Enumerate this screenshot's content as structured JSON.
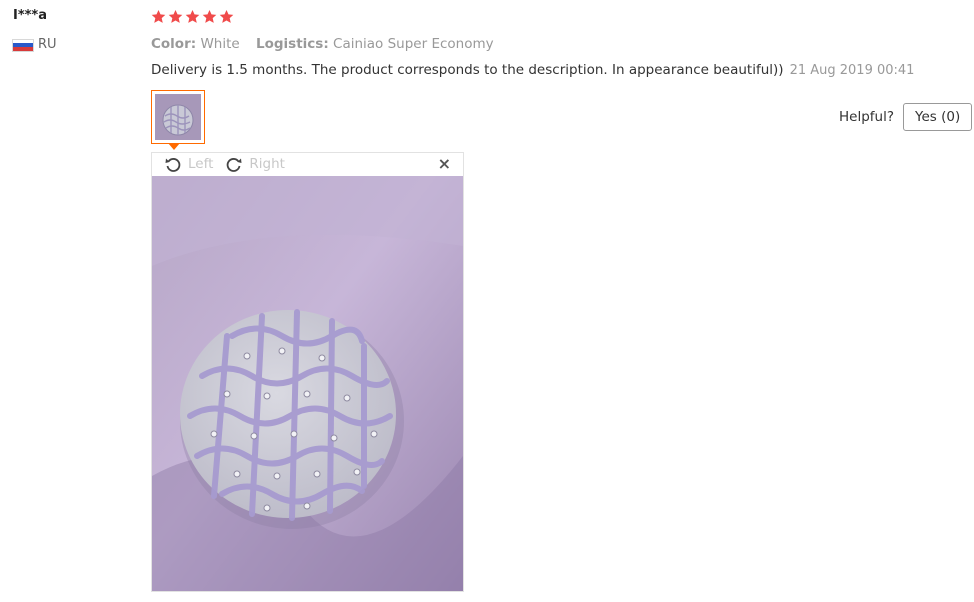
{
  "review": {
    "username": "I***a",
    "country_code": "RU",
    "rating": 5,
    "max_rating": 5,
    "color_label": "Color:",
    "color_value": "White",
    "logistics_label": "Logistics:",
    "logistics_value": "Cainiao Super Economy",
    "text": "Delivery is 1.5 months. The product corresponds to the description. In appearance beautiful))",
    "date": "21 Aug 2019 00:41"
  },
  "helpful": {
    "label": "Helpful?",
    "yes_label": "Yes (0)"
  },
  "viewer": {
    "rotate_left_label": "Left",
    "rotate_right_label": "Right",
    "close_glyph": "×"
  },
  "colors": {
    "star": "#f04b4b",
    "accent": "#ff6a00",
    "muted_text": "#999999",
    "photo_background": "#b9a6cc",
    "product": "#cfcfdc"
  },
  "icons": [
    "star-icon",
    "rotate-left-icon",
    "rotate-right-icon",
    "close-icon",
    "russia-flag-icon"
  ]
}
